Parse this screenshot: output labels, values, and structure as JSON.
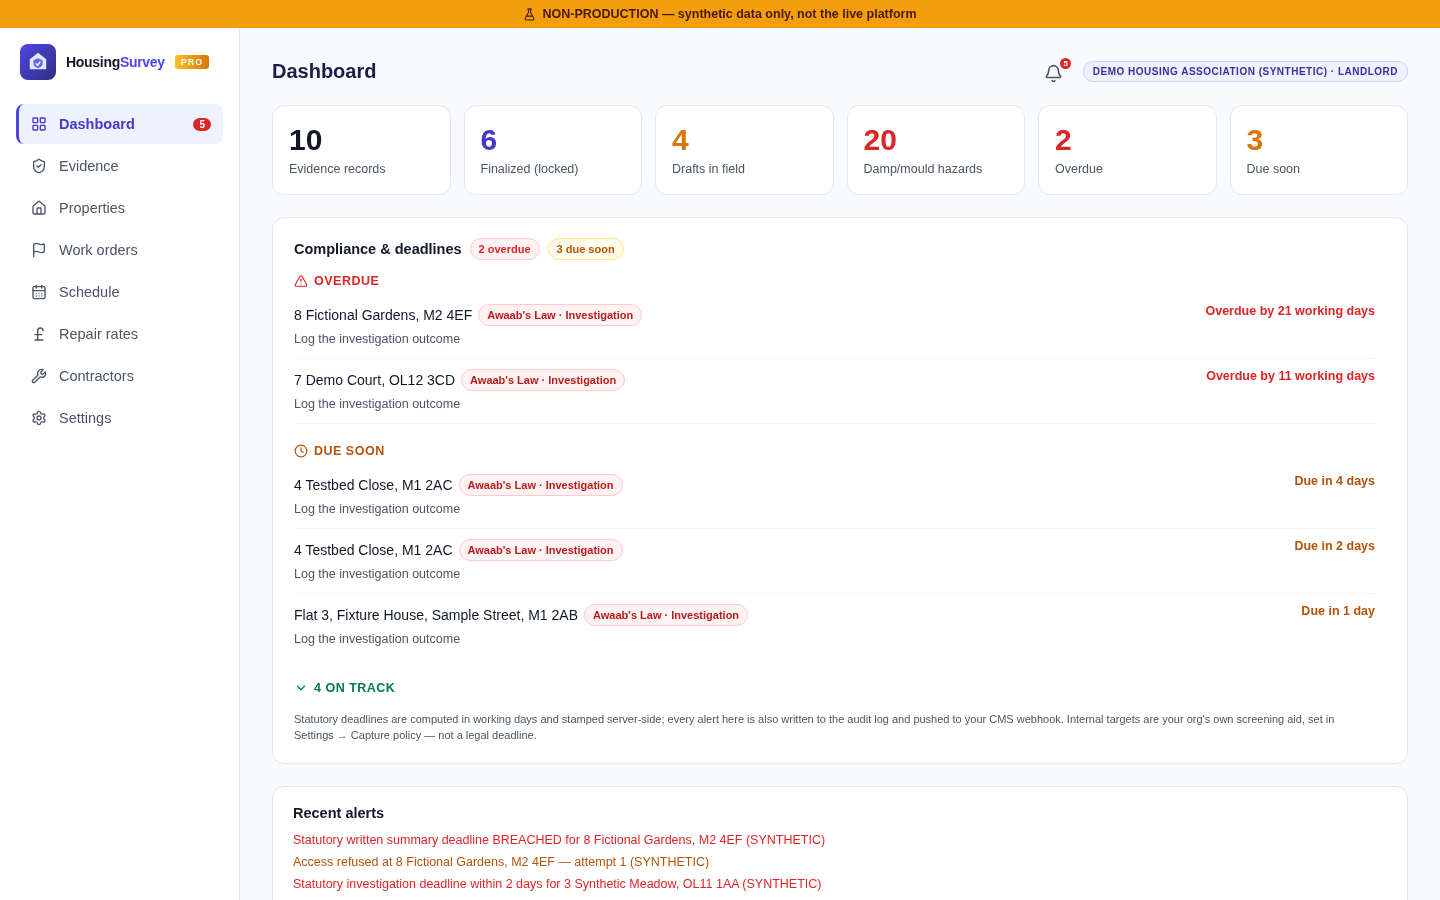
{
  "banner": {
    "text": "NON-PRODUCTION — synthetic data only, not the live platform"
  },
  "brand": {
    "name": "Housing",
    "accent": "Survey",
    "badge": "PRO"
  },
  "sidebar": {
    "items": [
      {
        "label": "Dashboard",
        "selected": true,
        "badge": "5"
      },
      {
        "label": "Evidence",
        "selected": false
      },
      {
        "label": "Properties",
        "selected": false
      },
      {
        "label": "Work orders",
        "selected": false
      },
      {
        "label": "Schedule",
        "selected": false
      },
      {
        "label": "Repair rates",
        "selected": false
      },
      {
        "label": "Contractors",
        "selected": false
      },
      {
        "label": "Settings",
        "selected": false
      }
    ]
  },
  "header": {
    "title": "Dashboard",
    "notifications": "5",
    "organisation": "DEMO HOUSING ASSOCIATION (SYNTHETIC) · LANDLORD"
  },
  "stats": [
    {
      "value": "10",
      "label": "Evidence records",
      "color": "#111827"
    },
    {
      "value": "6",
      "label": "Finalized (locked)",
      "color": "#4338ca"
    },
    {
      "value": "4",
      "label": "Drafts in field",
      "color": "#d97706"
    },
    {
      "value": "20",
      "label": "Damp/mould hazards",
      "color": "#dc2626"
    },
    {
      "value": "2",
      "label": "Overdue",
      "color": "#dc2626"
    },
    {
      "value": "3",
      "label": "Due soon",
      "color": "#d97706"
    }
  ],
  "compliance": {
    "title": "Compliance & deadlines",
    "badges": [
      {
        "text": "2 overdue",
        "kind": "overdue"
      },
      {
        "text": "3 due soon",
        "kind": "due_soon"
      }
    ],
    "sections": [
      {
        "kind": "overdue",
        "heading": "OVERDUE",
        "items": [
          {
            "address": "8 Fictional Gardens, M2 4EF",
            "tag": "Awaab's Law · Investigation",
            "action": "Log the investigation outcome",
            "deadline": "Overdue by 21 working days"
          },
          {
            "address": "7 Demo Court, OL12 3CD",
            "tag": "Awaab's Law · Investigation",
            "action": "Log the investigation outcome",
            "deadline": "Overdue by 11 working days"
          }
        ]
      },
      {
        "kind": "due_soon",
        "heading": "DUE SOON",
        "items": [
          {
            "address": "4 Testbed Close, M1 2AC",
            "tag": "Awaab's Law · Investigation",
            "action": "Log the investigation outcome",
            "deadline": "Due in 4 days"
          },
          {
            "address": "4 Testbed Close, M1 2AC",
            "tag": "Awaab's Law · Investigation",
            "action": "Log the investigation outcome",
            "deadline": "Due in 2 days"
          },
          {
            "address": "Flat 3, Fixture House, Sample Street, M1 2AB",
            "tag": "Awaab's Law · Investigation",
            "action": "Log the investigation outcome",
            "deadline": "Due in 1 day"
          }
        ]
      }
    ],
    "on_track": {
      "label": "4 ON TRACK",
      "expanded": false
    },
    "note": "Statutory deadlines are computed in working days and stamped server-side; every alert here is also written to the audit log and pushed to your CMS webhook. Internal targets are your org's own screening aid, set in Settings → Capture policy — not a legal deadline."
  },
  "recent_alerts": {
    "title": "Recent alerts",
    "items": [
      {
        "text": "Statutory written summary deadline BREACHED for 8 Fictional Gardens, M2 4EF (SYNTHETIC)",
        "kind": "breach"
      },
      {
        "text": "Access refused at 8 Fictional Gardens, M2 4EF — attempt 1 (SYNTHETIC)",
        "kind": "warning"
      },
      {
        "text": "Statutory investigation deadline within 2 days for 3 Synthetic Meadow, OL11 1AA (SYNTHETIC)",
        "kind": "breach"
      }
    ]
  }
}
